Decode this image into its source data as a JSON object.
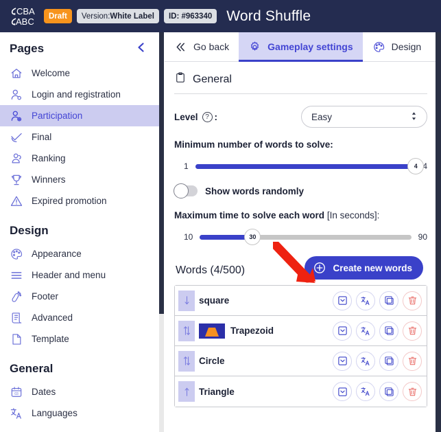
{
  "topbar": {
    "logo_name": "cba-abc-logo",
    "status_badge": "Draft",
    "version_prefix": "Version: ",
    "version_value": "White Label",
    "id_label": "ID: #963340",
    "app_title": "Word Shuffle",
    "bg_color": "#242c50",
    "draft_color": "#f7941d"
  },
  "sidebar": {
    "pages_title": "Pages",
    "collapse_icon": "chevron-left-icon",
    "pages_items": [
      {
        "label": "Welcome",
        "icon": "home-icon",
        "active": false
      },
      {
        "label": "Login and registration",
        "icon": "user-login-icon",
        "active": false
      },
      {
        "label": "Participation",
        "icon": "user-add-icon",
        "active": true
      },
      {
        "label": "Final",
        "icon": "check-icon",
        "active": false
      },
      {
        "label": "Ranking",
        "icon": "ranking-icon",
        "active": false
      },
      {
        "label": "Winners",
        "icon": "trophy-icon",
        "active": false
      },
      {
        "label": "Expired promotion",
        "icon": "warning-icon",
        "active": false
      }
    ],
    "design_title": "Design",
    "design_items": [
      {
        "label": "Appearance",
        "icon": "palette-icon"
      },
      {
        "label": "Header and menu",
        "icon": "menu-lines-icon"
      },
      {
        "label": "Footer",
        "icon": "footprint-icon"
      },
      {
        "label": "Advanced",
        "icon": "scroll-document-icon"
      },
      {
        "label": "Template",
        "icon": "page-icon"
      }
    ],
    "general_title": "General",
    "general_items": [
      {
        "label": "Dates",
        "icon": "calendar-icon"
      },
      {
        "label": "Languages",
        "icon": "translate-icon"
      }
    ],
    "active_bg": "#ccccf0",
    "active_text": "#4345d4"
  },
  "tabs": [
    {
      "label": "Go back",
      "icon": "double-chevron-left-icon",
      "active": false
    },
    {
      "label": "Gameplay settings",
      "icon": "gear-icon",
      "active": true
    },
    {
      "label": "Design",
      "icon": "palette-icon",
      "active": false
    }
  ],
  "general_section": {
    "icon": "clipboard-icon",
    "title": "General",
    "level": {
      "label": "Level",
      "help_icon": "question-mark-icon",
      "colon": ":",
      "selected": "Easy",
      "stepper_icon": "up-down-arrows-icon"
    },
    "min_words": {
      "label": "Minimum number of words to solve:",
      "min": "1",
      "max": "4",
      "value": "4",
      "fill_percent": 100
    },
    "show_random": {
      "label": "Show words randomly",
      "enabled": false
    },
    "max_time": {
      "label_bold": "Maximum time to solve each word ",
      "label_normal": "[In seconds]:",
      "min": "10",
      "max": "90",
      "value": "30",
      "fill_percent": 25
    }
  },
  "words": {
    "title": "Words (4/500)",
    "create_button": "Create new words",
    "create_icon": "plus-circle-icon",
    "accent_color": "#3a41c9",
    "rows": [
      {
        "name": "square",
        "drag_icon": "arrow-down-icon",
        "thumb": false
      },
      {
        "name": "Trapezoid",
        "drag_icon": "arrows-up-down-icon",
        "thumb": true,
        "thumb_shape": "trapezoid",
        "thumb_bg": "#2c2fa8",
        "thumb_fill": "#f79020"
      },
      {
        "name": "Circle",
        "drag_icon": "arrows-up-down-icon",
        "thumb": false
      },
      {
        "name": "Triangle",
        "drag_icon": "arrow-up-icon",
        "thumb": false
      }
    ],
    "row_actions": [
      {
        "icon": "expand-box-icon",
        "name": "expand-button"
      },
      {
        "icon": "translate-icon",
        "name": "translate-button"
      },
      {
        "icon": "duplicate-icon",
        "name": "duplicate-button"
      },
      {
        "icon": "trash-icon",
        "name": "delete-button"
      }
    ]
  },
  "annotation": {
    "icon": "red-arrow-pointer",
    "color": "#ee2211"
  }
}
